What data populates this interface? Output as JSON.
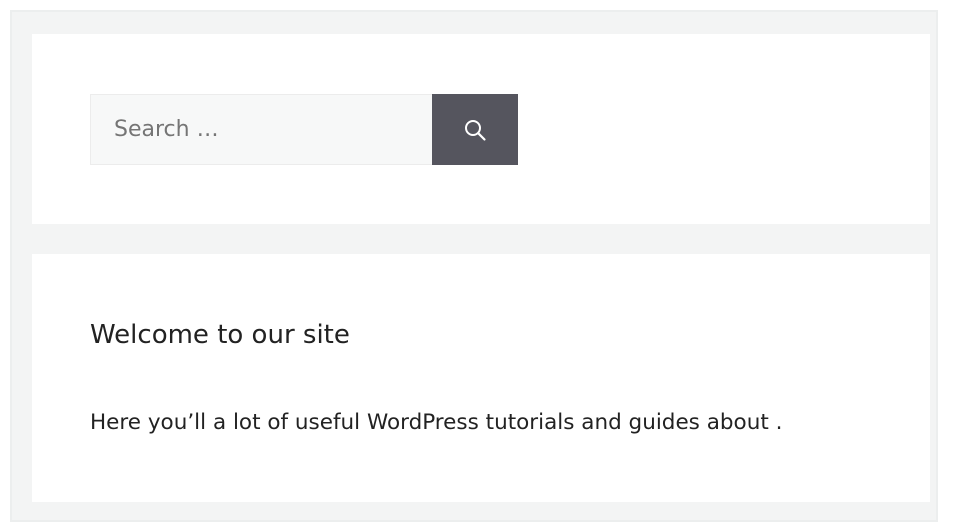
{
  "search_widget": {
    "placeholder": "Search …",
    "value": "",
    "submit_icon": "search-icon",
    "button_color": "#55555e"
  },
  "text_widget": {
    "title": "Welcome to our site",
    "body": "Here you’ll a lot of useful WordPress tutorials and guides about ."
  },
  "colors": {
    "background": "#f3f4f4",
    "widget_background": "#ffffff",
    "text": "#222222"
  }
}
